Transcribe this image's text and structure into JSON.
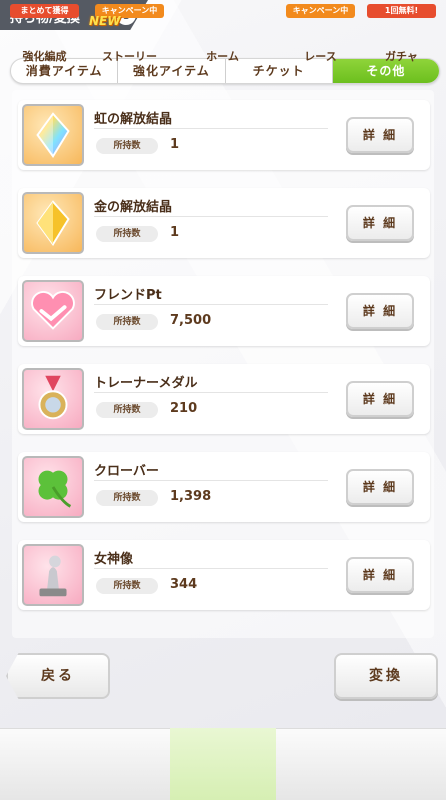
{
  "header": {
    "title": "持ち物/変換",
    "info_glyph": "i"
  },
  "tabs": [
    {
      "label": "消費アイテム",
      "active": false
    },
    {
      "label": "強化アイテム",
      "active": false
    },
    {
      "label": "チケット",
      "active": false
    },
    {
      "label": "その他",
      "active": true
    }
  ],
  "items": [
    {
      "name": "虹の解放結晶",
      "count_label": "所持数",
      "count": "1",
      "detail_label": "詳 細",
      "icon": "rainbow-crystal-icon"
    },
    {
      "name": "金の解放結晶",
      "count_label": "所持数",
      "count": "1",
      "detail_label": "詳 細",
      "icon": "gold-crystal-icon"
    },
    {
      "name": "フレンドPt",
      "count_label": "所持数",
      "count": "7,500",
      "detail_label": "詳 細",
      "icon": "handshake-icon"
    },
    {
      "name": "トレーナーメダル",
      "count_label": "所持数",
      "count": "210",
      "detail_label": "詳 細",
      "icon": "medal-icon"
    },
    {
      "name": "クローバー",
      "count_label": "所持数",
      "count": "1,398",
      "detail_label": "詳 細",
      "icon": "clover-icon"
    },
    {
      "name": "女神像",
      "count_label": "所持数",
      "count": "344",
      "detail_label": "詳 細",
      "icon": "goddess-statue-icon"
    }
  ],
  "buttons": {
    "back": "戻る",
    "convert": "変換"
  },
  "nav": [
    {
      "label": "強化編成",
      "badge": "まとめて獲得",
      "badge_color": "#e74d2e"
    },
    {
      "label": "ストーリー",
      "badge": "キャンペーン中",
      "badge_color": "#f28a1d",
      "new": "NEW"
    },
    {
      "label": "ホーム",
      "badge": ""
    },
    {
      "label": "レース",
      "badge": "キャンペーン中",
      "badge_color": "#f28a1d"
    },
    {
      "label": "ガチャ",
      "badge": "1回無料!",
      "badge_color": "#e74d2e"
    }
  ]
}
